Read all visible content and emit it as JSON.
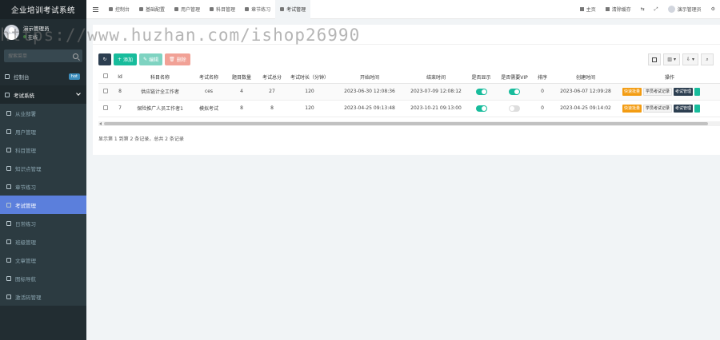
{
  "app": {
    "title": "企业培训考试系统"
  },
  "user": {
    "name": "演示管理员",
    "status": "在线"
  },
  "search": {
    "placeholder": "搜索菜单"
  },
  "sidebar": {
    "items": [
      {
        "label": "控制台",
        "badge": "hot"
      },
      {
        "label": "考试系统"
      },
      {
        "label": "从业部署"
      },
      {
        "label": "用户管理"
      },
      {
        "label": "科目管理"
      },
      {
        "label": "知识点管理"
      },
      {
        "label": "章节练习"
      },
      {
        "label": "考试管理"
      },
      {
        "label": "日常练习"
      },
      {
        "label": "班级管理"
      },
      {
        "label": "文章管理"
      },
      {
        "label": "图标导航"
      },
      {
        "label": "激活码管理"
      }
    ]
  },
  "topbar": {
    "tabs": [
      {
        "label": "控制台"
      },
      {
        "label": "基础配置"
      },
      {
        "label": "用户管理"
      },
      {
        "label": "科目管理"
      },
      {
        "label": "章节练习"
      },
      {
        "label": "考试管理"
      }
    ],
    "home": "主页",
    "clear_cache": "清除缓存",
    "username": "演示管理员"
  },
  "watermark": "https://www.huzhan.com/ishop26990",
  "toolbar": {
    "add": "添加",
    "edit": "编辑",
    "delete": "删除"
  },
  "table": {
    "headers": [
      "",
      "Id",
      "科目名称",
      "考试名称",
      "题目数量",
      "考试总分",
      "考试时长（分钟）",
      "开始时间",
      "结束时间",
      "是否显示",
      "是否需要VIP",
      "排序",
      "创建时间",
      "操作"
    ],
    "rows": [
      {
        "id": "8",
        "subject": "供应链计全工作者",
        "exam": "ces",
        "count": "4",
        "score": "27",
        "duration": "120",
        "start": "2023-06-30 12:08:36",
        "end": "2023-07-09 12:08:12",
        "show": true,
        "vip": true,
        "sort": "0",
        "created": "2023-06-07 12:09:28"
      },
      {
        "id": "7",
        "subject": "保险推广人员工作者1",
        "exam": "模拟考试",
        "count": "8",
        "score": "8",
        "duration": "120",
        "start": "2023-04-25 09:13:48",
        "end": "2023-10-21 09:13:00",
        "show": true,
        "vip": false,
        "sort": "0",
        "created": "2023-04-25 09:14:02"
      }
    ],
    "ops": {
      "a": "快速批量",
      "b": "学员考试记录",
      "c": "考试管理"
    }
  },
  "pagination": {
    "text": "显示第 1 到第 2 条记录，总共 2 条记录"
  }
}
